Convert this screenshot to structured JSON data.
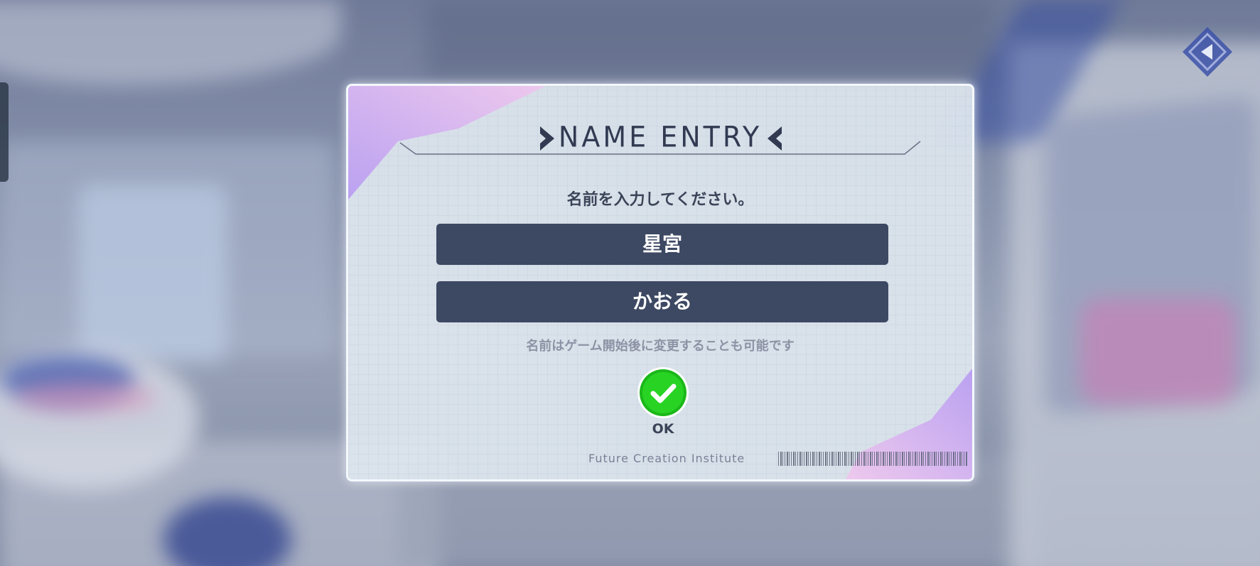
{
  "dialog": {
    "title": "NAME ENTRY",
    "prompt": "名前を入力してください。",
    "surname_value": "星宮",
    "given_name_value": "かおる",
    "note": "名前はゲーム開始後に変更することも可能です",
    "ok_label": "OK",
    "footer_text": "Future Creation Institute"
  },
  "colors": {
    "field_background": "#3d4863",
    "ok_green": "#22c41e",
    "accent_purple": "#c79cf0",
    "text_dark": "#3b4458"
  },
  "icons": {
    "ok": "checkmark-icon",
    "back": "back-arrow-icon"
  }
}
